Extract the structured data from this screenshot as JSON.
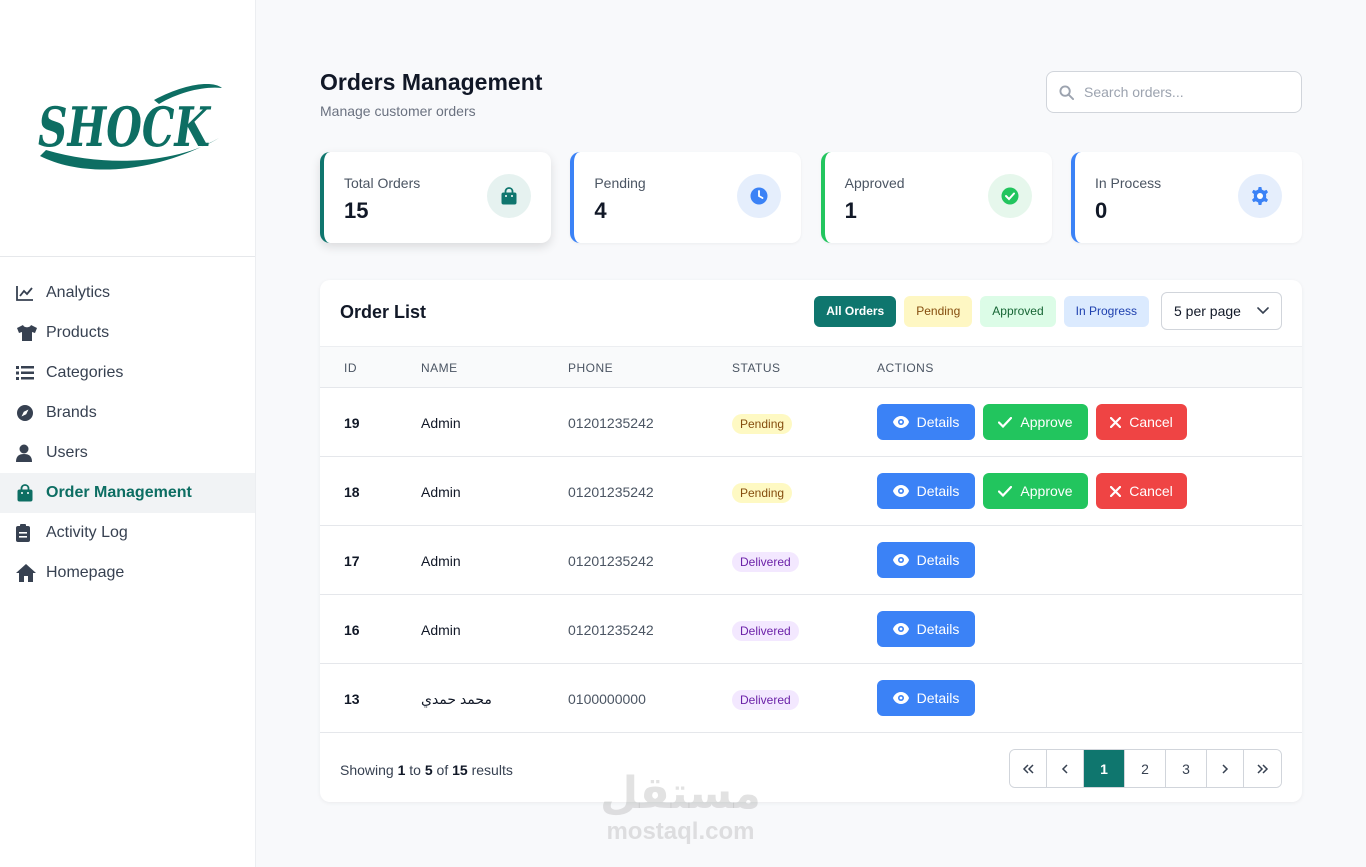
{
  "brand": {
    "logo_text": "SHOCK",
    "logo_color": "#0d6e63"
  },
  "sidebar": {
    "items": [
      {
        "label": "Analytics",
        "icon": "chart-line-icon",
        "active": false
      },
      {
        "label": "Products",
        "icon": "tshirt-icon",
        "active": false
      },
      {
        "label": "Categories",
        "icon": "list-icon",
        "active": false
      },
      {
        "label": "Brands",
        "icon": "compass-icon",
        "active": false
      },
      {
        "label": "Users",
        "icon": "user-icon",
        "active": false
      },
      {
        "label": "Order Management",
        "icon": "shopping-bag-icon",
        "active": true
      },
      {
        "label": "Activity Log",
        "icon": "clipboard-icon",
        "active": false
      },
      {
        "label": "Homepage",
        "icon": "home-icon",
        "active": false
      }
    ]
  },
  "header": {
    "title": "Orders Management",
    "subtitle": "Manage customer orders",
    "search_placeholder": "Search orders..."
  },
  "stats": [
    {
      "label": "Total Orders",
      "value": "15",
      "color": "#0f766e",
      "icon": "shopping-bag-icon"
    },
    {
      "label": "Pending",
      "value": "4",
      "color": "#3b82f6",
      "icon": "clock-icon"
    },
    {
      "label": "Approved",
      "value": "1",
      "color": "#22c55e",
      "icon": "check-circle-icon"
    },
    {
      "label": "In Process",
      "value": "0",
      "color": "#3b82f6",
      "icon": "gear-icon"
    }
  ],
  "order_list": {
    "title": "Order List",
    "filters": [
      "All Orders",
      "Pending",
      "Approved",
      "In Progress"
    ],
    "per_page": "5 per page",
    "columns": [
      "ID",
      "NAME",
      "PHONE",
      "STATUS",
      "ACTIONS"
    ],
    "rows": [
      {
        "id": "19",
        "name": "Admin",
        "phone": "01201235242",
        "status": "Pending"
      },
      {
        "id": "18",
        "name": "Admin",
        "phone": "01201235242",
        "status": "Pending"
      },
      {
        "id": "17",
        "name": "Admin",
        "phone": "01201235242",
        "status": "Delivered"
      },
      {
        "id": "16",
        "name": "Admin",
        "phone": "01201235242",
        "status": "Delivered"
      },
      {
        "id": "13",
        "name": "محمد حمدي",
        "phone": "0100000000",
        "status": "Delivered"
      }
    ],
    "action_labels": {
      "details": "Details",
      "approve": "Approve",
      "cancel": "Cancel"
    }
  },
  "footer": {
    "showing_prefix": "Showing",
    "from": "1",
    "to_word": "to",
    "to": "5",
    "of_word": "of",
    "total": "15",
    "suffix": "results",
    "pages": [
      "1",
      "2",
      "3"
    ],
    "current_page": "1"
  },
  "watermark": {
    "arabic": "مستقل",
    "latin": "mostaql.com"
  }
}
